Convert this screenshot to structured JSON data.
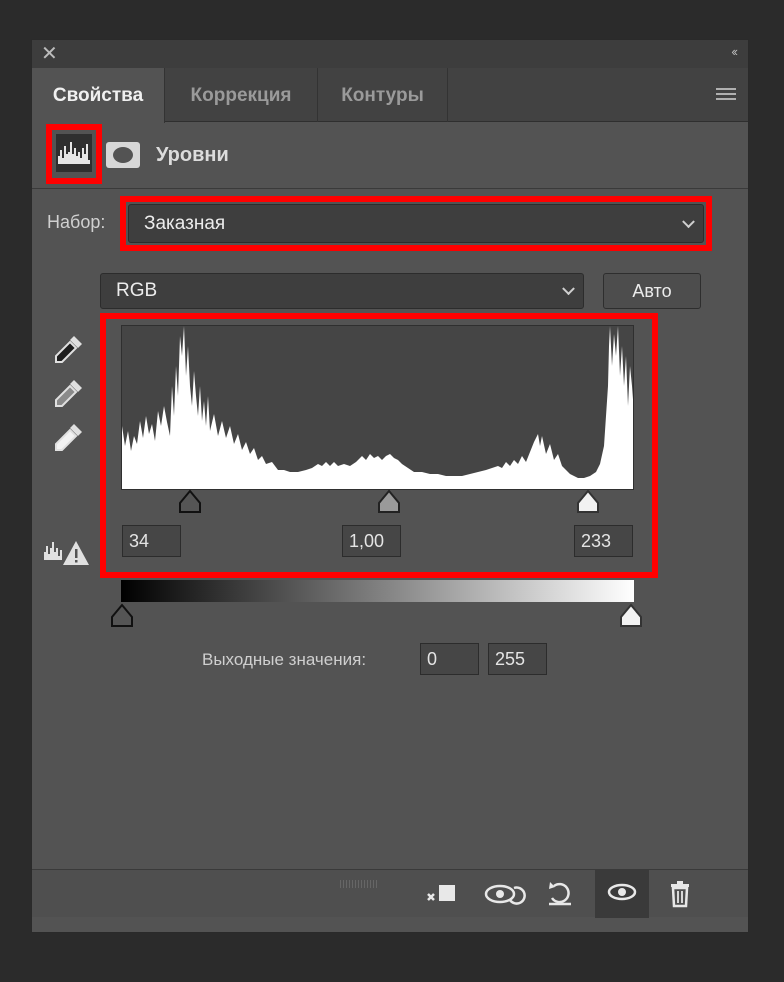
{
  "window": {
    "close_glyph": "✕",
    "collapse_glyph": "‹‹"
  },
  "tabs": [
    {
      "label": "Свойства",
      "active": true
    },
    {
      "label": "Коррекция",
      "active": false
    },
    {
      "label": "Контуры",
      "active": false
    }
  ],
  "header": {
    "title": "Уровни",
    "icons": [
      "levels-histogram-icon",
      "mask-icon"
    ]
  },
  "preset": {
    "label": "Набор:",
    "value": "Заказная"
  },
  "channel": {
    "value": "RGB",
    "auto_label": "Авто"
  },
  "input_levels": {
    "black": "34",
    "gamma": "1,00",
    "white": "233"
  },
  "output": {
    "label": "Выходные значения:",
    "black": "0",
    "white": "255"
  },
  "footer_icons": [
    "clip-to-layer-icon",
    "view-previous-state-icon",
    "reset-icon",
    "visibility-icon",
    "trash-icon"
  ],
  "colors": {
    "highlight": "#ff0000",
    "panel": "#535353",
    "tabbar": "#424242"
  }
}
